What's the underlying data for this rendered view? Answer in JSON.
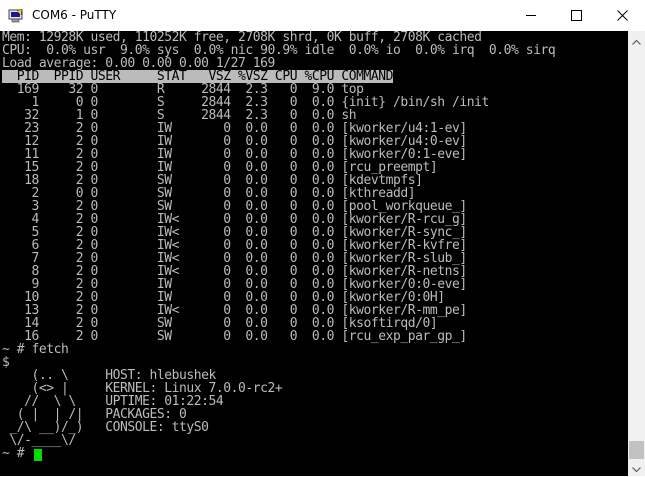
{
  "window": {
    "title": "COM6 - PuTTY",
    "icon": "putty-monitor-icon",
    "controls": {
      "minimize": "minimize-icon",
      "maximize": "maximize-icon",
      "close": "close-icon"
    }
  },
  "terminal": {
    "colors": {
      "background": "#000000",
      "text": "#bbbbbb",
      "header_bg": "#bbbbbb",
      "header_text": "#000000",
      "cursor": "#00dd00"
    },
    "lines": [
      "Mem: 12928K used, 110252K free, 2708K shrd, 0K buff, 2708K cached",
      "CPU:  0.0% usr  9.0% sys  0.0% nic 90.9% idle  0.0% io  0.0% irq  0.0% sirq",
      "Load average: 0.00 0.00 0.00 1/27 169",
      "  PID  PPID USER     STAT   VSZ %VSZ CPU %CPU COMMAND",
      "  169    32 0        R     2844  2.3   0  9.0 top",
      "    1     0 0        S     2844  2.3   0  0.0 {init} /bin/sh /init",
      "   32     1 0        S     2844  2.3   0  0.0 sh",
      "   23     2 0        IW       0  0.0   0  0.0 [kworker/u4:1-ev]",
      "   12     2 0        IW       0  0.0   0  0.0 [kworker/u4:0-ev]",
      "   11     2 0        IW       0  0.0   0  0.0 [kworker/0:1-eve]",
      "   15     2 0        IW       0  0.0   0  0.0 [rcu_preempt]",
      "   18     2 0        SW       0  0.0   0  0.0 [kdevtmpfs]",
      "    2     0 0        SW       0  0.0   0  0.0 [kthreadd]",
      "    3     2 0        SW       0  0.0   0  0.0 [pool_workqueue_]",
      "    4     2 0        IW<      0  0.0   0  0.0 [kworker/R-rcu_g]",
      "    5     2 0        IW<      0  0.0   0  0.0 [kworker/R-sync_]",
      "    6     2 0        IW<      0  0.0   0  0.0 [kworker/R-kvfre]",
      "    7     2 0        IW<      0  0.0   0  0.0 [kworker/R-slub_]",
      "    8     2 0        IW<      0  0.0   0  0.0 [kworker/R-netns]",
      "    9     2 0        IW       0  0.0   0  0.0 [kworker/0:0-eve]",
      "   10     2 0        IW       0  0.0   0  0.0 [kworker/0:0H]",
      "   13     2 0        IW<      0  0.0   0  0.0 [kworker/R-mm_pe]",
      "   14     2 0        SW       0  0.0   0  0.0 [ksoftirqd/0]",
      "   16     2 0        SW       0  0.0   0  0.0 [rcu_exp_par_gp_]",
      "~ # fetch",
      "$",
      "    (.. \\     HOST: hlebushek",
      "    (<> |     KERNEL: Linux 7.0.0-rc2+",
      "   //  \\ \\    UPTIME: 01:22:54",
      "  ( |  | /|   PACKAGES: 0",
      " _/\\ __)/_)   CONSOLE: ttyS0",
      " \\/-____\\/",
      "~ # "
    ]
  }
}
